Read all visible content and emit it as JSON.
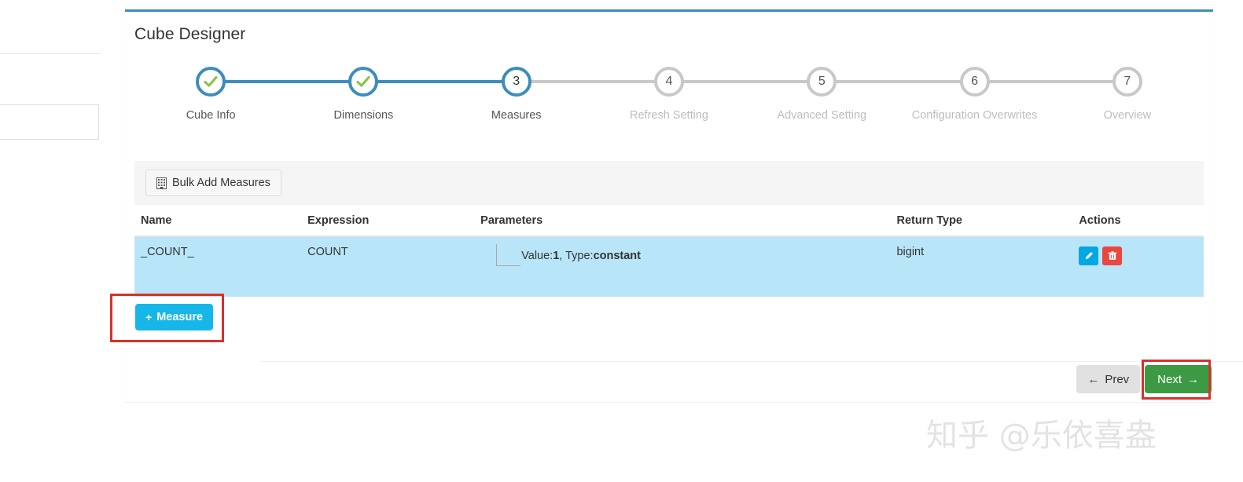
{
  "panel": {
    "title": "Cube Designer",
    "accent_color": "#3c8dbc"
  },
  "stepper": {
    "steps": [
      {
        "num": "1",
        "label": "Cube Info",
        "state": "done"
      },
      {
        "num": "2",
        "label": "Dimensions",
        "state": "done"
      },
      {
        "num": "3",
        "label": "Measures",
        "state": "active"
      },
      {
        "num": "4",
        "label": "Refresh Setting",
        "state": "todo"
      },
      {
        "num": "5",
        "label": "Advanced Setting",
        "state": "todo"
      },
      {
        "num": "6",
        "label": "Configuration Overwrites",
        "state": "todo"
      },
      {
        "num": "7",
        "label": "Overview",
        "state": "todo"
      }
    ]
  },
  "toolbar": {
    "bulk_add_label": "Bulk Add Measures",
    "bulk_add_icon": "building-icon"
  },
  "table": {
    "headers": {
      "name": "Name",
      "expression": "Expression",
      "parameters": "Parameters",
      "return_type": "Return Type",
      "actions": "Actions"
    },
    "rows": [
      {
        "name": "_COUNT_",
        "expression": "COUNT",
        "param_prefix": "Value:",
        "param_value": "1",
        "param_sep": ", Type:",
        "param_type": "constant",
        "return_type": "bigint",
        "row_highlight_color": "#b9e5f9",
        "edit_icon": "pencil-icon",
        "delete_icon": "trash-icon"
      }
    ]
  },
  "add_measure": {
    "label": "Measure",
    "plus": "+",
    "color": "#16b7e8"
  },
  "footer": {
    "prev_label": "Prev",
    "prev_arrow": "←",
    "next_label": "Next",
    "next_arrow": "→",
    "next_color": "#3c9a44"
  },
  "annotations": {
    "color": "#d6322a",
    "measure_box": "highlight-add-measure",
    "next_box": "highlight-next"
  },
  "watermark": {
    "text": "知乎 @乐依喜盎"
  }
}
